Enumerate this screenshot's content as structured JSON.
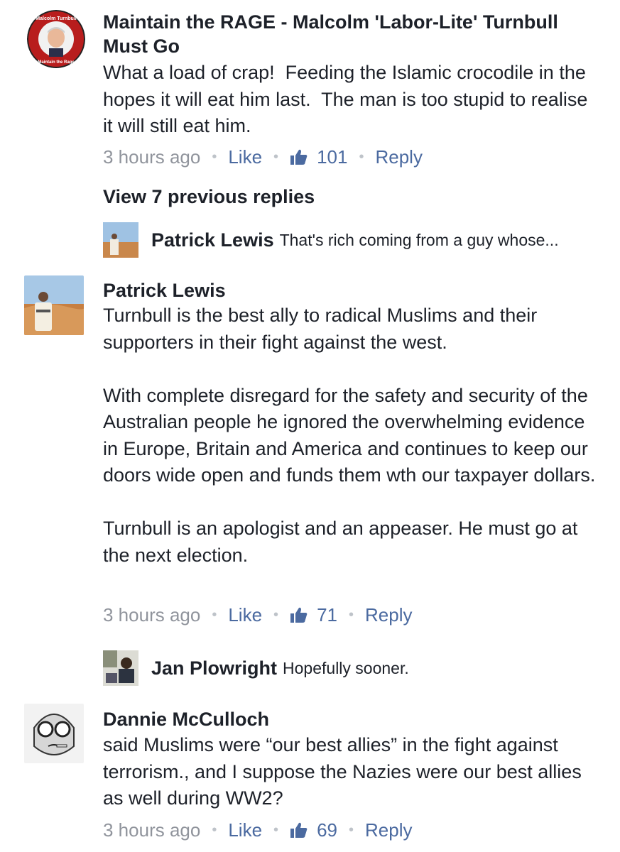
{
  "comments": [
    {
      "author": "Maintain the RAGE - Malcolm 'Labor-Lite' Turnbull Must Go",
      "avatar_text_top": "Malcolm Turnbull",
      "avatar_text_bottom": "Maintain the Rage",
      "text": "What a load of crap!  Feeding the Islamic crocodile in the hopes it will eat him last.  The man is too stupid to realise it will still eat him.",
      "time": "3 hours ago",
      "like_label": "Like",
      "reactions": "101",
      "reply_label": "Reply"
    },
    {
      "author": "Patrick Lewis",
      "text": "Turnbull is the best ally to radical Muslims and their supporters in their fight against the west.\n\nWith complete disregard for the safety and security of the Australian people he ignored the overwhelming evidence in Europe, Britain and America and continues to keep our doors wide open and funds them wth our taxpayer dollars.\n\nTurnbull is an apologist and an appeaser. He must go at the next election.",
      "time": "3 hours ago",
      "like_label": "Like",
      "reactions": "71",
      "reply_label": "Reply"
    },
    {
      "author": "Dannie McCulloch",
      "text": "said Muslims were “our best allies” in the fight against terrorism., and I suppose the Nazies were our best allies as well during WW2?",
      "time": "3 hours ago",
      "like_label": "Like",
      "reactions": "69",
      "reply_label": "Reply"
    }
  ],
  "view_previous": "View 7 previous replies",
  "replies": [
    {
      "name": "Patrick Lewis",
      "text": "That's rich coming from a guy whose..."
    },
    {
      "name": "Jan Plowright",
      "text": "Hopefully sooner."
    }
  ],
  "colors": {
    "link": "#4b6aa0",
    "muted": "#90949c",
    "text": "#1d2129"
  },
  "icons": {
    "reaction": "thumbs-up-icon"
  }
}
